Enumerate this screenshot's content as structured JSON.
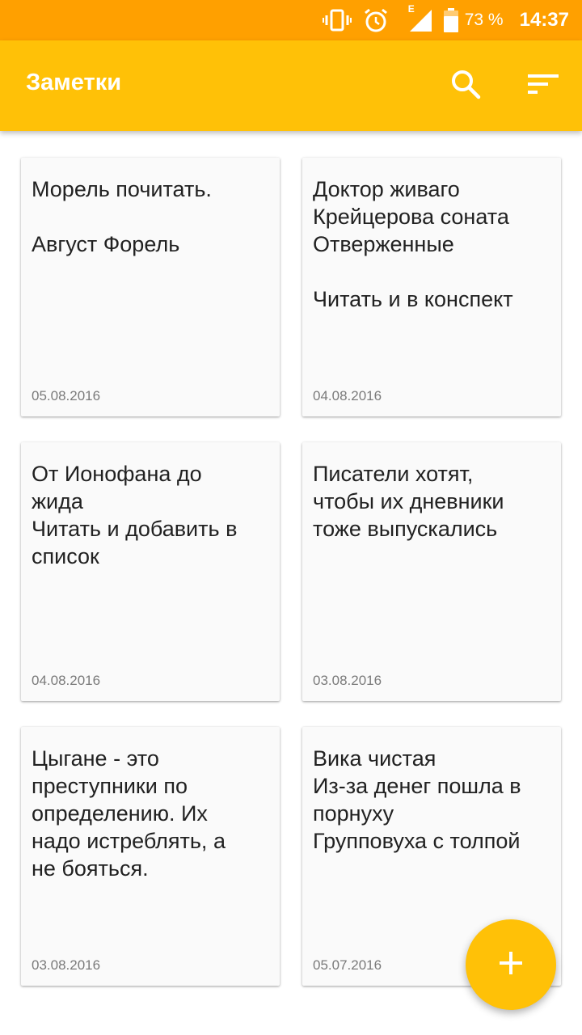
{
  "status_bar": {
    "icons": [
      "vibrate-icon",
      "alarm-icon",
      "signal-icon",
      "battery-icon"
    ],
    "network_label": "E",
    "battery_percent": "73 %",
    "time": "14:37"
  },
  "app_bar": {
    "title": "Заметки",
    "actions": [
      "search-icon",
      "sort-icon"
    ]
  },
  "notes": [
    {
      "text": "Морель почитать.\n\nАвгуст Форель",
      "date": "05.08.2016"
    },
    {
      "text": "Доктор живаго\nКрейцерова соната\nОтверженные\n\nЧитать и в конспект",
      "date": "04.08.2016"
    },
    {
      "text": "От Ионофана до\nжида\nЧитать и добавить в\nсписок",
      "date": "04.08.2016"
    },
    {
      "text": "Писатели хотят,\nчтобы их дневники\nтоже выпускались",
      "date": "03.08.2016"
    },
    {
      "text": "Цыгане - это\nпреступники по\nопределению. Их\nнадо истреблять, а\nне бояться.",
      "date": "03.08.2016"
    },
    {
      "text": "Вика чистая\nИз-за денег пошла в\nпорнуху\nГрупповуха с толпой",
      "date": "05.07.2016"
    }
  ],
  "fab": {
    "icon": "plus-icon"
  },
  "colors": {
    "status_bar": "#FFA000",
    "app_bar": "#FFC107",
    "card": "#FAFAFA",
    "text": "#212121",
    "date": "#7a7a7a"
  }
}
